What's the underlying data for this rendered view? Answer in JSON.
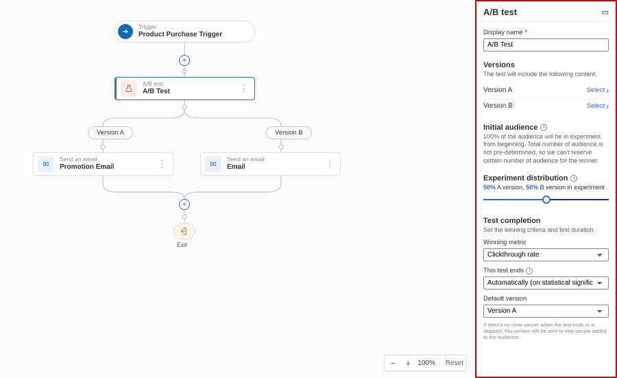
{
  "canvas": {
    "trigger": {
      "sub": "Trigger",
      "title": "Product Purchase Trigger"
    },
    "abtest": {
      "sub": "A/B test",
      "title": "A/B Test"
    },
    "versionA_pill": "Version A",
    "versionB_pill": "Version B",
    "emailA": {
      "sub": "Send an email",
      "title": "Promotion Email"
    },
    "emailB": {
      "sub": "Send an email",
      "title": "Email"
    },
    "exit": "Exit",
    "zoom": {
      "value": "100%",
      "reset": "Reset"
    }
  },
  "panel": {
    "title": "A/B test",
    "displayName": {
      "label": "Display name",
      "value": "A/B Test"
    },
    "versions": {
      "heading": "Versions",
      "desc": "The test will include the following content.",
      "a": "Version A",
      "b": "Version B",
      "select": "Select"
    },
    "audience": {
      "heading": "Initial audience",
      "desc": "100% of the audience will be in experiment from beginning. Total number of audience is not pre-determined, so we can't reserve certain number of audience for the winner."
    },
    "distribution": {
      "heading": "Experiment distribution",
      "a_pct": "50%",
      "a_label": "A version,",
      "b_pct": "50%",
      "b_label": "B version in experiment"
    },
    "completion": {
      "heading": "Test completion",
      "desc": "Set the winning criteria and test duration.",
      "metric_label": "Winning metric",
      "metric_value": "Clickthrough rate",
      "ends_label": "This test ends",
      "ends_value": "Automatically (on statistical significance)",
      "default_label": "Default version",
      "default_value": "Version A",
      "footnote": "If there's no clear winner when the test ends or is stopped, this version will be sent to new people added to the audience."
    }
  }
}
